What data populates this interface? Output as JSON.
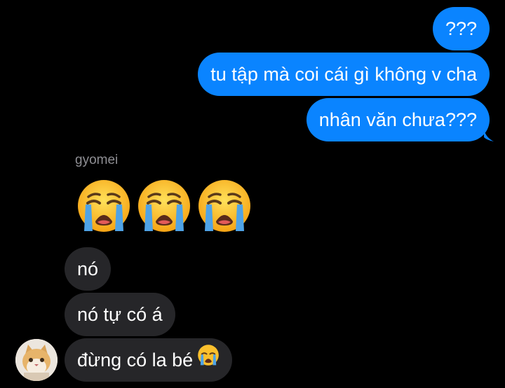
{
  "outgoing": [
    {
      "text": "???"
    },
    {
      "text": "tu tập mà coi cái gì không v cha"
    },
    {
      "text": "nhân văn chưa???"
    }
  ],
  "sender_name": "gyomei",
  "big_emojis": [
    "loudly-crying-face",
    "loudly-crying-face",
    "loudly-crying-face"
  ],
  "incoming": [
    {
      "text": "nó"
    },
    {
      "text": "nó tự có á"
    },
    {
      "text": "đừng có la bé",
      "emoji": "loudly-crying-face"
    }
  ],
  "colors": {
    "outgoing_bubble": "#0a84ff",
    "incoming_bubble": "#262629",
    "background": "#000000",
    "sender_name": "#8e8e93"
  }
}
